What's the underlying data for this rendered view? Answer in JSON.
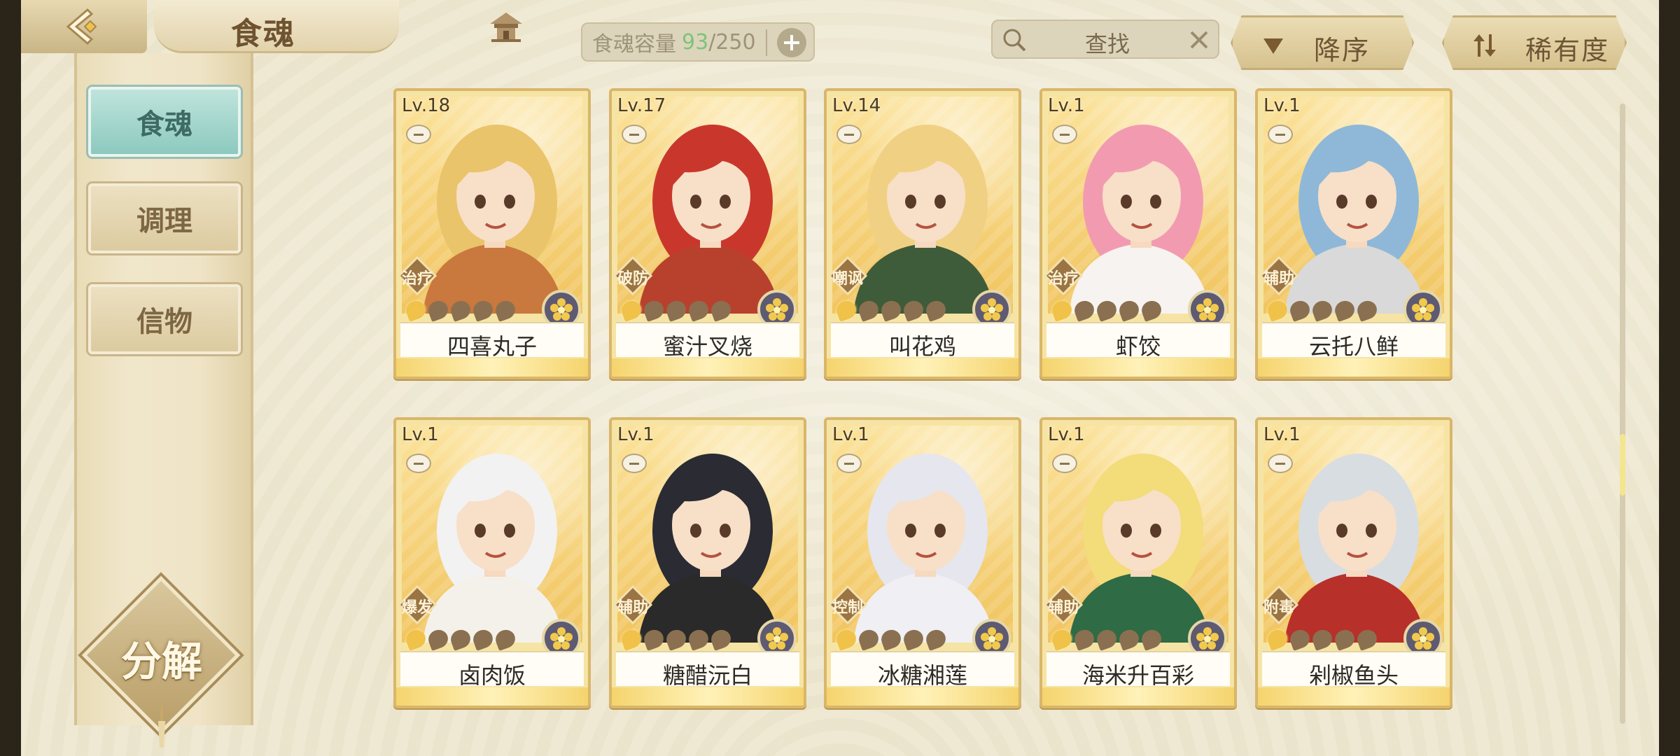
{
  "header": {
    "title": "食魂",
    "capacity": {
      "label": "食魂容量",
      "current": "93",
      "total": "/250"
    },
    "search_label": "查找",
    "sort_order_label": "降序",
    "sort_key_label": "稀有度"
  },
  "sidebar": {
    "tabs": [
      {
        "label": "食魂",
        "active": true
      },
      {
        "label": "调理",
        "active": false
      },
      {
        "label": "信物",
        "active": false
      }
    ],
    "decompose_label": "分解"
  },
  "cards": [
    {
      "level": "Lv.18",
      "role": "治疗",
      "name": "四喜丸子",
      "hair": "#e9c46a",
      "outfit": "#c9783e",
      "stars_lit": 1
    },
    {
      "level": "Lv.17",
      "role": "破防",
      "name": "蜜汁叉烧",
      "hair": "#c9372c",
      "outfit": "#b8412e",
      "stars_lit": 1
    },
    {
      "level": "Lv.14",
      "role": "嘲讽",
      "name": "叫花鸡",
      "hair": "#f0d184",
      "outfit": "#3f5c3a",
      "stars_lit": 1
    },
    {
      "level": "Lv.1",
      "role": "治疗",
      "name": "虾饺",
      "hair": "#f29bb0",
      "outfit": "#f7f3f1",
      "stars_lit": 1
    },
    {
      "level": "Lv.1",
      "role": "辅助",
      "name": "云托八鲜",
      "hair": "#8fb8d8",
      "outfit": "#d9d9d9",
      "stars_lit": 1
    },
    {
      "level": "Lv.1",
      "role": "爆发",
      "name": "卤肉饭",
      "hair": "#f2f2f2",
      "outfit": "#f4f1ea",
      "stars_lit": 1
    },
    {
      "level": "Lv.1",
      "role": "辅助",
      "name": "糖醋沅白",
      "hair": "#2b2b33",
      "outfit": "#2a2a2a",
      "stars_lit": 1
    },
    {
      "level": "Lv.1",
      "role": "控制",
      "name": "冰糖湘莲",
      "hair": "#e6e6ee",
      "outfit": "#efeff4",
      "stars_lit": 1
    },
    {
      "level": "Lv.1",
      "role": "辅助",
      "name": "海米升百彩",
      "hair": "#f3dc7a",
      "outfit": "#2f6b45",
      "stars_lit": 1
    },
    {
      "level": "Lv.1",
      "role": "附毒",
      "name": "剁椒鱼头",
      "hair": "#d8dde2",
      "outfit": "#b8302a",
      "stars_lit": 1
    }
  ]
}
